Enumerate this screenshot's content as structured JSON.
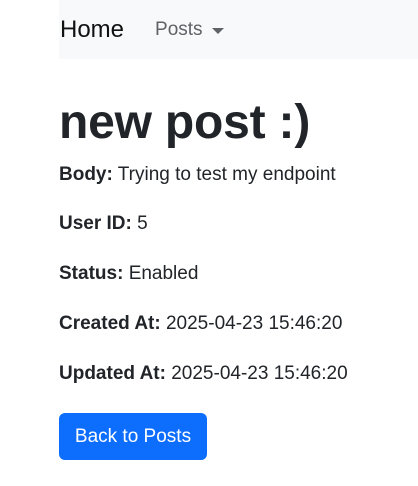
{
  "navbar": {
    "brand": "Home",
    "posts_label": "Posts"
  },
  "post": {
    "title": "new post :)",
    "fields": [
      {
        "label": "Body:",
        "value": "Trying to test my endpoint"
      },
      {
        "label": "User ID:",
        "value": "5"
      },
      {
        "label": "Status:",
        "value": "Enabled"
      },
      {
        "label": "Created At:",
        "value": "2025-04-23 15:46:20"
      },
      {
        "label": "Updated At:",
        "value": "2025-04-23 15:46:20"
      }
    ]
  },
  "actions": {
    "back_label": "Back to Posts"
  },
  "colors": {
    "navbar_bg": "#f8f9fa",
    "primary": "#0d6efd",
    "text": "#212529",
    "muted": "#5f6367"
  },
  "icons": {
    "dropdown": "chevron-down-icon"
  }
}
